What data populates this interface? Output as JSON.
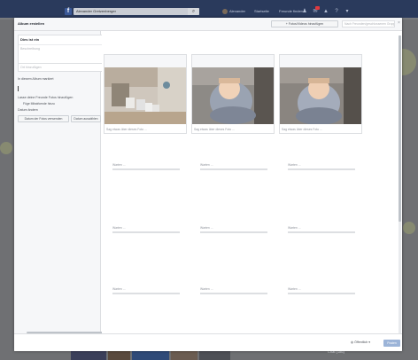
{
  "fb": {
    "search_value": "Alexander Gretzenberger",
    "nav_user": "Alexander",
    "nav_home": "Startseite",
    "nav_find": "Freunde finden"
  },
  "modal": {
    "title": "Album erstellen",
    "add_button": "+ Fotos/Videos hinzufügen",
    "people_search_placeholder": "Nach Freunden/geschlossenen Gruppen suchen",
    "close": "×"
  },
  "left": {
    "name_value": "Dies ist ein",
    "description_placeholder": "Beschreibung",
    "location_placeholder": "Ort hinzufügen",
    "tagged_label": "In diesem Album markiert",
    "contribute_label": "Lasse deine Freunde Fotos hinzufügen",
    "contributors_placeholder": "Füge Mitwirkende hinzu",
    "date_label": "Datum ändern",
    "use_photo_date": "Datum der Fotos verwenden",
    "choose_date": "Datum auswählen"
  },
  "photos": [
    {
      "caption": "Sag etwas über dieses Foto ..."
    },
    {
      "caption": "Sag etwas über dieses Foto ..."
    },
    {
      "caption": "Sag etwas über dieses Foto ..."
    }
  ],
  "slot_label": "Warten ...",
  "footer": {
    "privacy": "Öffentlich",
    "post": "Posten"
  },
  "bottom": {
    "chat": "Chat (186)"
  }
}
